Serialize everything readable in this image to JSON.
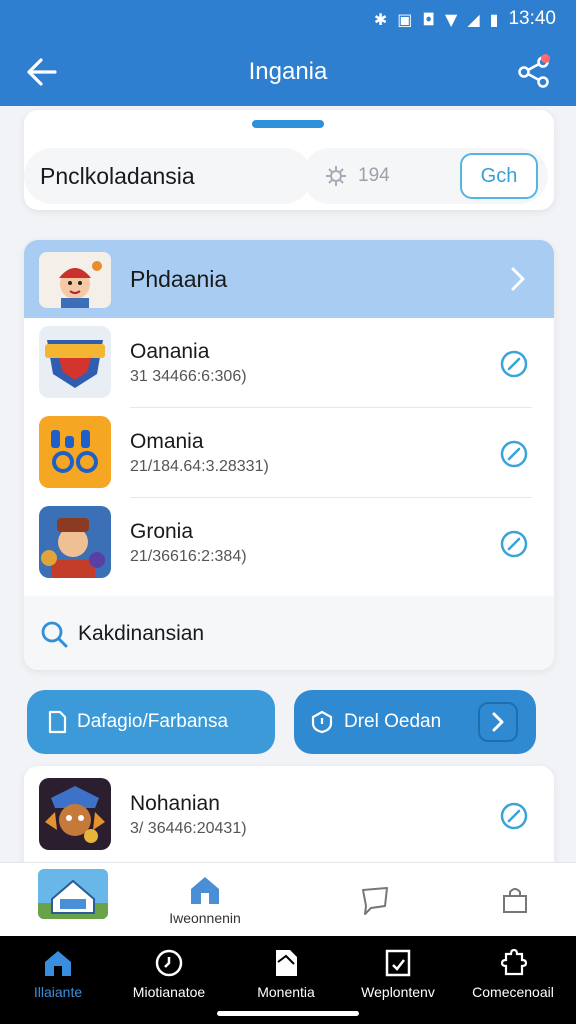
{
  "status_bar": {
    "time": "13:40",
    "icons": [
      "bluetooth-icon",
      "nfc-icon",
      "vibrate-icon",
      "wifi-icon",
      "signal-icon",
      "battery-icon"
    ]
  },
  "app_bar": {
    "title": "Ingania"
  },
  "search": {
    "value": "Pnclkoladansia",
    "count": "194",
    "go_label": "Gch"
  },
  "list": {
    "header_label": "Phdaania",
    "rows": [
      {
        "name": "Oanania",
        "meta": "31 34466:6:306)"
      },
      {
        "name": "Omania",
        "meta": "21/184.64:3.28331)"
      },
      {
        "name": "Gronia",
        "meta": "21/36616:2:384)"
      }
    ],
    "search_row_label": "Kakdinansian"
  },
  "actions": {
    "left_label": "Dafagio/Farbansa",
    "right_label": "Drel Oedan"
  },
  "bottom_item": {
    "name": "Nohanian",
    "meta": "3/ 36446:20431)"
  },
  "tab_strip": {
    "home_label": "Iweonnenin"
  },
  "nav": [
    {
      "label": "Illaiante",
      "icon": "home-icon"
    },
    {
      "label": "Miotianatoe",
      "icon": "clock-icon"
    },
    {
      "label": "Monentia",
      "icon": "document-icon"
    },
    {
      "label": "Weplontenv",
      "icon": "checkbox-icon"
    },
    {
      "label": "Comecenoail",
      "icon": "puzzle-icon"
    }
  ],
  "colors": {
    "primary": "#2f7fd0",
    "accent": "#3a9fd6",
    "header_highlight": "#a9cdf2",
    "nav_active": "#3a8ee0"
  }
}
